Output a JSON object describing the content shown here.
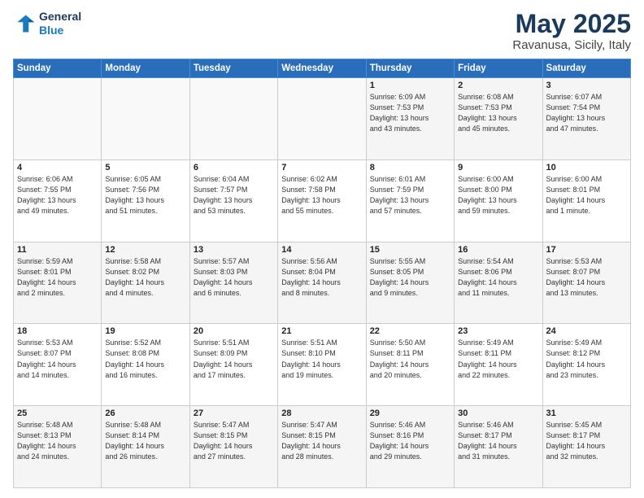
{
  "header": {
    "logo_line1": "General",
    "logo_line2": "Blue",
    "title": "May 2025",
    "subtitle": "Ravanusa, Sicily, Italy"
  },
  "weekdays": [
    "Sunday",
    "Monday",
    "Tuesday",
    "Wednesday",
    "Thursday",
    "Friday",
    "Saturday"
  ],
  "weeks": [
    [
      {
        "day": "",
        "info": ""
      },
      {
        "day": "",
        "info": ""
      },
      {
        "day": "",
        "info": ""
      },
      {
        "day": "",
        "info": ""
      },
      {
        "day": "1",
        "info": "Sunrise: 6:09 AM\nSunset: 7:53 PM\nDaylight: 13 hours\nand 43 minutes."
      },
      {
        "day": "2",
        "info": "Sunrise: 6:08 AM\nSunset: 7:53 PM\nDaylight: 13 hours\nand 45 minutes."
      },
      {
        "day": "3",
        "info": "Sunrise: 6:07 AM\nSunset: 7:54 PM\nDaylight: 13 hours\nand 47 minutes."
      }
    ],
    [
      {
        "day": "4",
        "info": "Sunrise: 6:06 AM\nSunset: 7:55 PM\nDaylight: 13 hours\nand 49 minutes."
      },
      {
        "day": "5",
        "info": "Sunrise: 6:05 AM\nSunset: 7:56 PM\nDaylight: 13 hours\nand 51 minutes."
      },
      {
        "day": "6",
        "info": "Sunrise: 6:04 AM\nSunset: 7:57 PM\nDaylight: 13 hours\nand 53 minutes."
      },
      {
        "day": "7",
        "info": "Sunrise: 6:02 AM\nSunset: 7:58 PM\nDaylight: 13 hours\nand 55 minutes."
      },
      {
        "day": "8",
        "info": "Sunrise: 6:01 AM\nSunset: 7:59 PM\nDaylight: 13 hours\nand 57 minutes."
      },
      {
        "day": "9",
        "info": "Sunrise: 6:00 AM\nSunset: 8:00 PM\nDaylight: 13 hours\nand 59 minutes."
      },
      {
        "day": "10",
        "info": "Sunrise: 6:00 AM\nSunset: 8:01 PM\nDaylight: 14 hours\nand 1 minute."
      }
    ],
    [
      {
        "day": "11",
        "info": "Sunrise: 5:59 AM\nSunset: 8:01 PM\nDaylight: 14 hours\nand 2 minutes."
      },
      {
        "day": "12",
        "info": "Sunrise: 5:58 AM\nSunset: 8:02 PM\nDaylight: 14 hours\nand 4 minutes."
      },
      {
        "day": "13",
        "info": "Sunrise: 5:57 AM\nSunset: 8:03 PM\nDaylight: 14 hours\nand 6 minutes."
      },
      {
        "day": "14",
        "info": "Sunrise: 5:56 AM\nSunset: 8:04 PM\nDaylight: 14 hours\nand 8 minutes."
      },
      {
        "day": "15",
        "info": "Sunrise: 5:55 AM\nSunset: 8:05 PM\nDaylight: 14 hours\nand 9 minutes."
      },
      {
        "day": "16",
        "info": "Sunrise: 5:54 AM\nSunset: 8:06 PM\nDaylight: 14 hours\nand 11 minutes."
      },
      {
        "day": "17",
        "info": "Sunrise: 5:53 AM\nSunset: 8:07 PM\nDaylight: 14 hours\nand 13 minutes."
      }
    ],
    [
      {
        "day": "18",
        "info": "Sunrise: 5:53 AM\nSunset: 8:07 PM\nDaylight: 14 hours\nand 14 minutes."
      },
      {
        "day": "19",
        "info": "Sunrise: 5:52 AM\nSunset: 8:08 PM\nDaylight: 14 hours\nand 16 minutes."
      },
      {
        "day": "20",
        "info": "Sunrise: 5:51 AM\nSunset: 8:09 PM\nDaylight: 14 hours\nand 17 minutes."
      },
      {
        "day": "21",
        "info": "Sunrise: 5:51 AM\nSunset: 8:10 PM\nDaylight: 14 hours\nand 19 minutes."
      },
      {
        "day": "22",
        "info": "Sunrise: 5:50 AM\nSunset: 8:11 PM\nDaylight: 14 hours\nand 20 minutes."
      },
      {
        "day": "23",
        "info": "Sunrise: 5:49 AM\nSunset: 8:11 PM\nDaylight: 14 hours\nand 22 minutes."
      },
      {
        "day": "24",
        "info": "Sunrise: 5:49 AM\nSunset: 8:12 PM\nDaylight: 14 hours\nand 23 minutes."
      }
    ],
    [
      {
        "day": "25",
        "info": "Sunrise: 5:48 AM\nSunset: 8:13 PM\nDaylight: 14 hours\nand 24 minutes."
      },
      {
        "day": "26",
        "info": "Sunrise: 5:48 AM\nSunset: 8:14 PM\nDaylight: 14 hours\nand 26 minutes."
      },
      {
        "day": "27",
        "info": "Sunrise: 5:47 AM\nSunset: 8:15 PM\nDaylight: 14 hours\nand 27 minutes."
      },
      {
        "day": "28",
        "info": "Sunrise: 5:47 AM\nSunset: 8:15 PM\nDaylight: 14 hours\nand 28 minutes."
      },
      {
        "day": "29",
        "info": "Sunrise: 5:46 AM\nSunset: 8:16 PM\nDaylight: 14 hours\nand 29 minutes."
      },
      {
        "day": "30",
        "info": "Sunrise: 5:46 AM\nSunset: 8:17 PM\nDaylight: 14 hours\nand 31 minutes."
      },
      {
        "day": "31",
        "info": "Sunrise: 5:45 AM\nSunset: 8:17 PM\nDaylight: 14 hours\nand 32 minutes."
      }
    ]
  ]
}
